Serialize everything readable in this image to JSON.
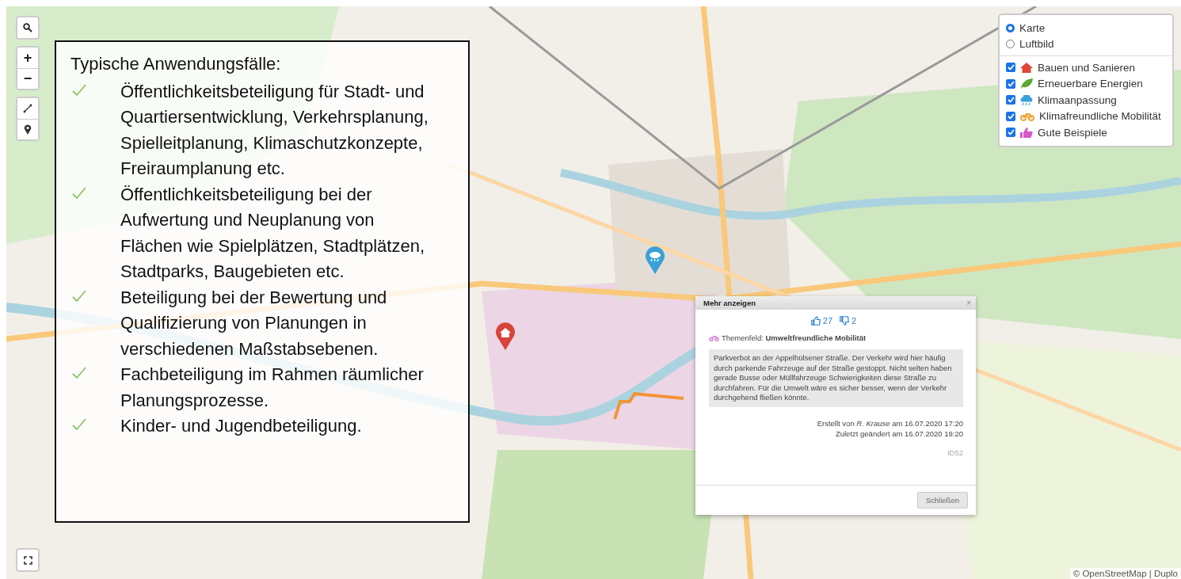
{
  "map_controls": {
    "zoom_in": "+",
    "zoom_out": "−"
  },
  "info_box": {
    "title": "Typische Anwendungsfälle:",
    "items": [
      "Öffentlichkeitsbeteiligung für Stadt- und Quartiersentwicklung, Verkehrsplanung, Spielleitplanung, Klimaschutzkonzepte, Freiraumplanung etc.",
      "Öffentlichkeitsbeteiligung bei der Aufwertung und Neuplanung von Flächen wie Spielplätzen, Stadtplätzen, Stadtparks, Baugebieten etc.",
      "Beteiligung bei der Bewertung und Qualifizierung von Planungen in verschiedenen Maßstabsebenen.",
      "Fachbeteiligung im Rahmen räumlicher Planungsprozesse.",
      "Kinder- und Jugendbeteiligung."
    ]
  },
  "layer_control": {
    "base_layers": [
      {
        "label": "Karte",
        "selected": true
      },
      {
        "label": "Luftbild",
        "selected": false
      }
    ],
    "overlays": [
      {
        "label": "Bauen und Sanieren",
        "checked": true,
        "kind": "house",
        "color": "#e0453a"
      },
      {
        "label": "Erneuerbare Energien",
        "checked": true,
        "kind": "leaf",
        "color": "#5aa832"
      },
      {
        "label": "Klimaanpassung",
        "checked": true,
        "kind": "weather",
        "color": "#3aa0d8"
      },
      {
        "label": "Klimafreundliche Mobilität",
        "checked": true,
        "kind": "bike",
        "color": "#f0a030"
      },
      {
        "label": "Gute Beispiele",
        "checked": true,
        "kind": "thumb",
        "color": "#d35ac8"
      }
    ]
  },
  "popup": {
    "title": "Mehr anzeigen",
    "close": "×",
    "likes": "27",
    "dislikes": "2",
    "topic": "Themenfeld: **Umweltfreundliche Mobilität**",
    "text": "Parkverbot an der Appelhülsener Straße. Der Verkehr wird hier häufig durch parkende Fahrzeuge auf der Straße gestoppt. Nicht selten haben gerade Busse oder Müllfahrzeuge Schwierigkeiten diese Straße zu durchfahren. Für die Umwelt wäre es sicher besser, wenn der Verkehr durchgehend fließen könnte.",
    "created": "Erstellt von *R. Krause* am 16.07.2020 17:20",
    "modified": "Zuletzt geändert am 16.07.2020 19:20",
    "id": "ID52",
    "button": "Schließen"
  },
  "attribution": "© OpenStreetMap | Duplo"
}
